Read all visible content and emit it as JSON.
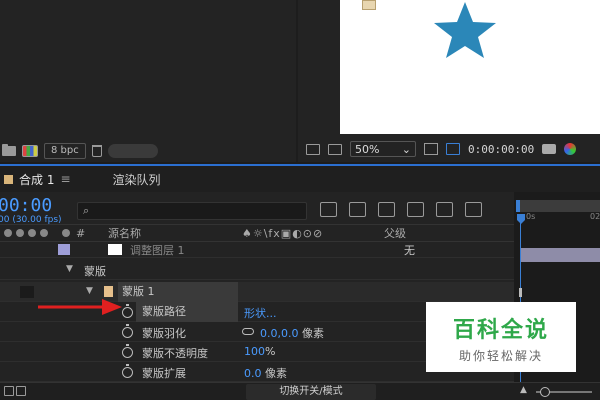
{
  "project_panel": {
    "bpc": "8 bpc"
  },
  "viewer": {
    "zoom": "50%",
    "timecode": "0:00:00:00",
    "star_color": "#2b87b8"
  },
  "timeline": {
    "tabs": [
      {
        "label": "合成 1",
        "menu": "≡"
      },
      {
        "label": "渲染队列"
      }
    ],
    "timecode": "00:00",
    "fps": "00 (30.00 fps)",
    "search_glyph": "⌕",
    "columns": {
      "hash": "#",
      "source_name": "源名称",
      "switches": "♠☼\\fx▣◐⊙⊘",
      "parent": "父级"
    },
    "rows": [
      {
        "label": "调整图层 1",
        "parent_value": "无"
      },
      {
        "label": "蒙版"
      },
      {
        "label": "蒙版 1"
      },
      {
        "label": "蒙版路径",
        "value": "形状..."
      },
      {
        "label": "蒙版羽化",
        "value": "0.0,0.0",
        "unit": "像素"
      },
      {
        "label": "蒙版不透明度",
        "value": "100",
        "unit": "%"
      },
      {
        "label": "蒙版扩展",
        "value": "0.0",
        "unit": "像素"
      }
    ],
    "ruler": {
      "label_a": "0s",
      "label_b": "02"
    },
    "bottom": {
      "switch_mode": "切换开关/模式"
    }
  },
  "watermark": {
    "title": "百科全说",
    "subtitle": "助你轻松解决"
  },
  "colors": {
    "accent": "#2b6fd1",
    "timecode": "#4a9bff",
    "arrow": "#e02020",
    "watermark_green": "#2fa84a",
    "layer_bar": "#8e8ca8"
  }
}
